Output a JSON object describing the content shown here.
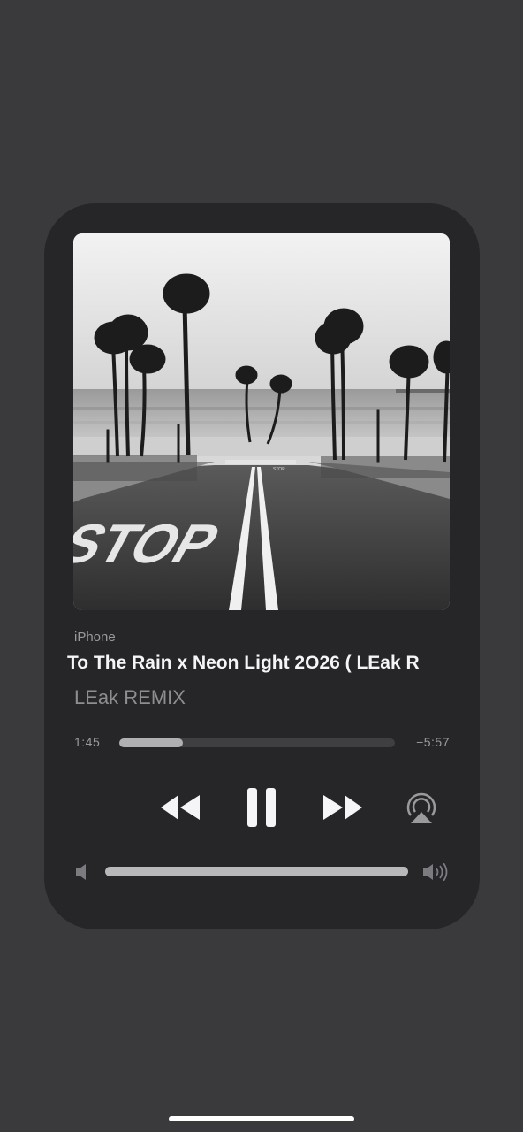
{
  "now_playing": {
    "device": "iPhone",
    "title": "To The Rain x Neon Light 2O26 ( LEak R",
    "artist": "LEak REMIX",
    "elapsed": "1:45",
    "remaining": "−5:57",
    "progress_fraction": 0.23,
    "artwork_text": "STOP"
  },
  "controls": {
    "rewind_icon": "backward-icon",
    "pause_icon": "pause-icon",
    "forward_icon": "forward-icon",
    "airplay_icon": "airplay-icon"
  },
  "volume": {
    "level_fraction": 1.0,
    "min_icon": "speaker-low-icon",
    "max_icon": "speaker-high-icon"
  },
  "colors": {
    "background": "#3a3a3c",
    "card": "#262628",
    "text_primary": "#f5f5f7",
    "text_secondary": "#8e8e92"
  }
}
